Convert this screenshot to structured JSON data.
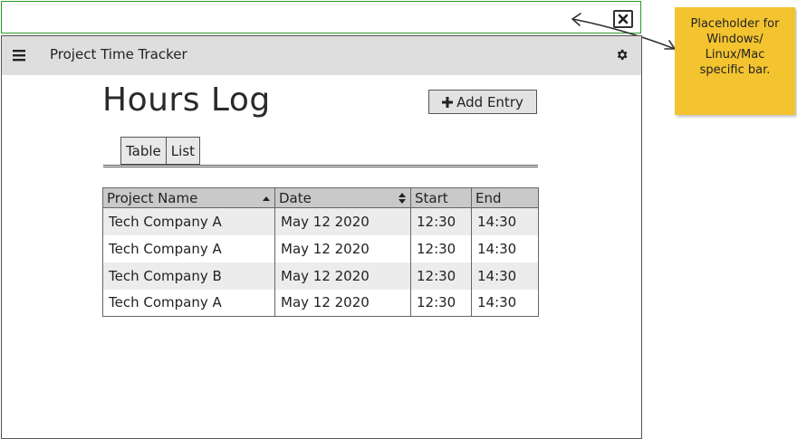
{
  "window": {
    "placeholder_note": "Placeholder for Windows/ Linux/Mac specific bar."
  },
  "header": {
    "title": "Project Time Tracker",
    "menu_icon": "hamburger-menu-icon",
    "settings_icon": "gear-icon"
  },
  "main": {
    "title": "Hours Log",
    "add_button": {
      "icon": "plus-icon",
      "label": "Add Entry"
    },
    "tabs": [
      {
        "label": "Table"
      },
      {
        "label": "List"
      }
    ],
    "table": {
      "columns": [
        {
          "label": "Project Name",
          "sort": "ascending"
        },
        {
          "label": "Date",
          "sort": "sortable"
        },
        {
          "label": "Start"
        },
        {
          "label": "End"
        }
      ],
      "rows": [
        {
          "project": "Tech Company A",
          "date": "May 12 2020",
          "start": "12:30",
          "end": "14:30"
        },
        {
          "project": "Tech Company A",
          "date": "May 12 2020",
          "start": "12:30",
          "end": "14:30"
        },
        {
          "project": "Tech Company B",
          "date": "May 12 2020",
          "start": "12:30",
          "end": "14:30"
        },
        {
          "project": "Tech Company A",
          "date": "May 12 2020",
          "start": "12:30",
          "end": "14:30"
        }
      ]
    }
  }
}
